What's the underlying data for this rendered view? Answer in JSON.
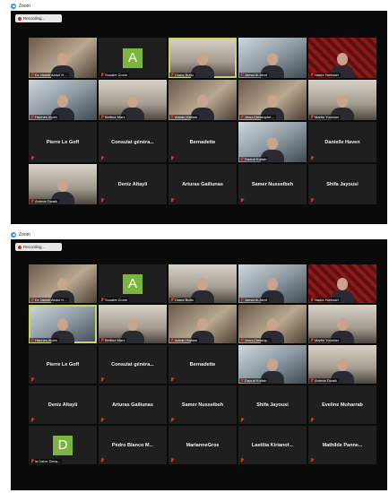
{
  "app": {
    "title": "Zoom",
    "recording_label": "Recording..."
  },
  "screens": [
    {
      "tiles": [
        {
          "type": "video",
          "style": "v3",
          "label": "Dr. Mahdi Abdul H..."
        },
        {
          "type": "avatar",
          "letter": "A",
          "label": "Soualer Zoom"
        },
        {
          "type": "video",
          "style": "v5",
          "label": "Diana Buttu",
          "active": true
        },
        {
          "type": "video",
          "style": "v2",
          "label": "Jamal Al-Atraf"
        },
        {
          "type": "video",
          "style": "v4",
          "label": "Nadia Harhash"
        },
        {
          "type": "video",
          "style": "v2",
          "label": "Hannes Alpen"
        },
        {
          "type": "video",
          "style": "v5",
          "label": "Bettina Marx"
        },
        {
          "type": "video",
          "style": "v3",
          "label": "Adnan Hallam"
        },
        {
          "type": "video",
          "style": "v3",
          "label": "Jean-Christophe..."
        },
        {
          "type": "video",
          "style": "v5",
          "label": "Martin Yourdan"
        },
        {
          "type": "name",
          "label": "Pierre Le Goff"
        },
        {
          "type": "name",
          "label": "Consulat généra..."
        },
        {
          "type": "name",
          "label": "Bernadette"
        },
        {
          "type": "video",
          "style": "v2",
          "label": "Daoud Kuttab"
        },
        {
          "type": "name",
          "label": "Danielle Haven"
        },
        {
          "type": "video",
          "style": "v5",
          "label": "Ammar Dwaik"
        },
        {
          "type": "name",
          "label": "Deniz Altayli"
        },
        {
          "type": "name",
          "label": "Arturas Gailiunas"
        },
        {
          "type": "name",
          "label": "Samer Nusseibeh"
        },
        {
          "type": "name",
          "label": "Shifa Jayousi"
        }
      ]
    },
    {
      "tiles": [
        {
          "type": "video",
          "style": "v3",
          "label": "Dr. Mahdi Abdul H..."
        },
        {
          "type": "avatar",
          "letter": "A",
          "label": "Soualer Zoom"
        },
        {
          "type": "video",
          "style": "v5",
          "label": "Diana Buttu"
        },
        {
          "type": "video",
          "style": "v2",
          "label": "Jamal Al-Atraf"
        },
        {
          "type": "video",
          "style": "v4",
          "label": "Nadia Harhash"
        },
        {
          "type": "video",
          "style": "v2",
          "label": "Hannes Alpen",
          "active": true
        },
        {
          "type": "video",
          "style": "v5",
          "label": "Bettina Marx"
        },
        {
          "type": "video",
          "style": "v3",
          "label": "Adnan Hallam"
        },
        {
          "type": "video",
          "style": "v3",
          "label": "Jean-Christop..."
        },
        {
          "type": "video",
          "style": "v5",
          "label": "Martin Yourdan"
        },
        {
          "type": "name",
          "label": "Pierre Le Goff"
        },
        {
          "type": "name",
          "label": "Consulat généra..."
        },
        {
          "type": "name",
          "label": "Bernadette"
        },
        {
          "type": "video",
          "style": "v2",
          "label": "Daoud Kuttab"
        },
        {
          "type": "video",
          "style": "v5",
          "label": "Ammar Dwaik"
        },
        {
          "type": "name",
          "label": "Deniz Altayli"
        },
        {
          "type": "name",
          "label": "Arturas Gailiunas"
        },
        {
          "type": "name",
          "label": "Samer Nusseibeh"
        },
        {
          "type": "name",
          "label": "Shifa Jayousi"
        },
        {
          "type": "name",
          "label": "Eveline Muharrab"
        },
        {
          "type": "avatar",
          "letter": "D",
          "label": "la Daive Dena..."
        },
        {
          "type": "name",
          "label": "Pedro Blanco M..."
        },
        {
          "type": "name",
          "label": "MarianneGros"
        },
        {
          "type": "name",
          "label": "Laetitia Kirianof..."
        },
        {
          "type": "name",
          "label": "Mathilde Panne..."
        }
      ]
    }
  ],
  "colors": {
    "active_speaker": "#c8d45a",
    "avatar_bg": "#7bb53d",
    "mic_muted": "#e02f2f",
    "zoom_blue": "#2d8cff"
  }
}
